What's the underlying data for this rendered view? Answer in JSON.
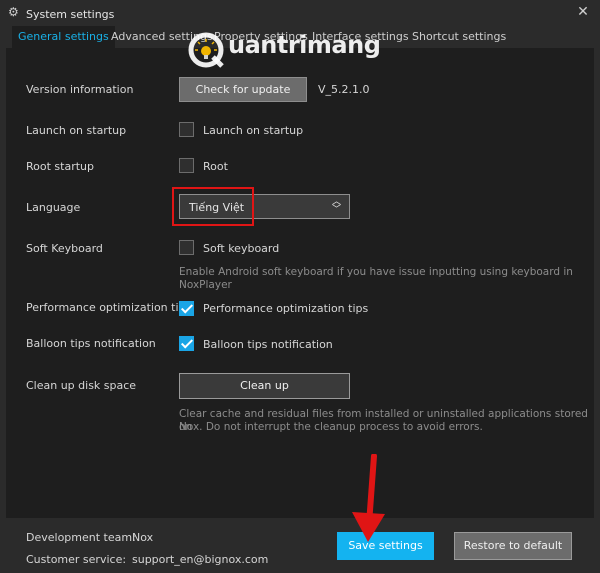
{
  "window": {
    "title": "System settings"
  },
  "tabs": [
    {
      "label": "General settings"
    },
    {
      "label": "Advanced settings"
    },
    {
      "label": "Property settings"
    },
    {
      "label": "Interface settings"
    },
    {
      "label": "Shortcut settings"
    }
  ],
  "watermark": {
    "text": "uantrimang"
  },
  "version": {
    "label": "Version information",
    "button": "Check for update",
    "value": "V_5.2.1.0"
  },
  "launch": {
    "label": "Launch on startup",
    "checkbox_label": "Launch on startup",
    "checked": false
  },
  "root": {
    "label": "Root startup",
    "checkbox_label": "Root",
    "checked": false
  },
  "language": {
    "label": "Language",
    "selected": "Tiếng Việt"
  },
  "keyboard": {
    "label": "Soft Keyboard",
    "checkbox_label": "Soft keyboard",
    "checked": false,
    "hint_line1": "Enable Android soft keyboard if you have issue inputting using keyboard in",
    "hint_line2": "NoxPlayer"
  },
  "performance": {
    "label": "Performance optimization tips",
    "checkbox_label": "Performance optimization tips",
    "checked": true
  },
  "balloon": {
    "label": "Balloon tips notification",
    "checkbox_label": "Balloon tips notification",
    "checked": true
  },
  "cleanup": {
    "label": "Clean up disk space",
    "button": "Clean up",
    "hint_line1": "Clear cache and residual files from installed or uninstalled applications stored on",
    "hint_line2": "Nox. Do not interrupt the cleanup process to avoid errors."
  },
  "footer": {
    "team_label": "Development team:",
    "team_value": "Nox",
    "service_label": "Customer service:",
    "service_value": "support_en@bignox.com",
    "save_button": "Save settings",
    "restore_button": "Restore to default"
  },
  "colors": {
    "accent": "#14b3f0",
    "highlight": "#e01515",
    "panel": "#1e1e1e",
    "chrome": "#2b2b2b"
  },
  "icons": {
    "title": "gear-icon",
    "close": "close-icon",
    "select": "updown-chevron-icon",
    "annotation": "red-arrow-icon"
  }
}
